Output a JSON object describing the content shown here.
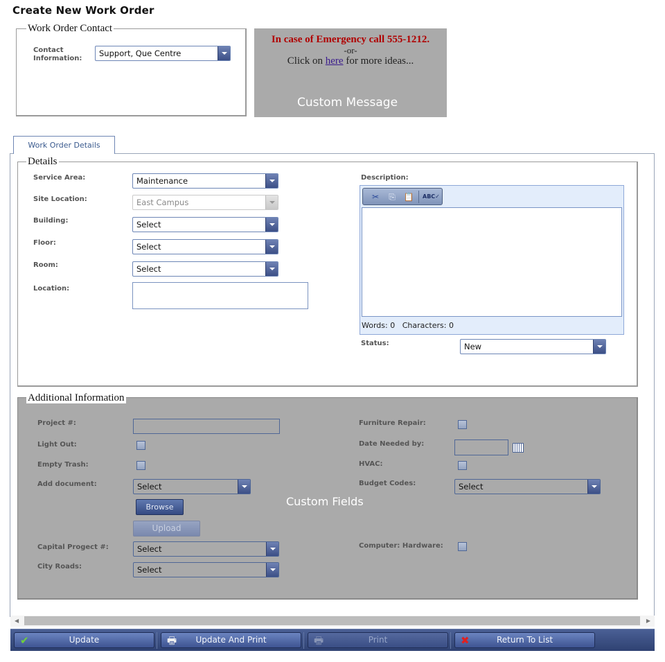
{
  "page": {
    "title": "Create New Work Order"
  },
  "contact": {
    "legend": "Work Order Contact",
    "label_line1": "Contact",
    "label_line2": "Information:",
    "value": "Support, Que Centre"
  },
  "custom_message": {
    "emergency": "In case of Emergency call 555-1212.",
    "or": "-or-",
    "click_prefix": "Click on ",
    "link_text": "here",
    "click_suffix": " for more ideas...",
    "overlay_label": "Custom Message"
  },
  "tabs": [
    {
      "label": "Work Order Details",
      "active": true
    }
  ],
  "details": {
    "legend": "Details",
    "fields": {
      "service_area": {
        "label": "Service Area:",
        "value": "Maintenance"
      },
      "site_location": {
        "label": "Site Location:",
        "value": "East Campus",
        "disabled": true
      },
      "building": {
        "label": "Building:",
        "value": "Select"
      },
      "floor": {
        "label": "Floor:",
        "value": "Select"
      },
      "room": {
        "label": "Room:",
        "value": "Select"
      },
      "location": {
        "label": "Location:",
        "value": ""
      }
    },
    "description": {
      "label": "Description:",
      "toolbar": [
        "cut-icon",
        "copy-icon",
        "paste-icon",
        "spellcheck-icon"
      ],
      "words_label": "Words: 0",
      "characters_label": "Characters: 0",
      "value": ""
    },
    "status": {
      "label": "Status:",
      "value": "New"
    }
  },
  "additional": {
    "legend": "Additional Information",
    "overlay_label": "Custom Fields",
    "left": {
      "project": {
        "label": "Project #:",
        "value": ""
      },
      "light_out": {
        "label": "Light Out:",
        "checked": false
      },
      "empty_trash": {
        "label": "Empty Trash:",
        "checked": false
      },
      "add_document": {
        "label": "Add document:",
        "value": "Select"
      },
      "browse_label": "Browse",
      "upload_label": "Upload",
      "capital_project": {
        "label": "Capital Progect #:",
        "value": "Select"
      },
      "city_roads": {
        "label": "City Roads:",
        "value": "Select"
      }
    },
    "right": {
      "furniture_repair": {
        "label": "Furniture Repair:",
        "checked": false
      },
      "date_needed": {
        "label": "Date Needed by:",
        "value": ""
      },
      "hvac": {
        "label": "HVAC:",
        "checked": false
      },
      "budget_codes": {
        "label": "Budget Codes:",
        "value": "Select"
      },
      "computer_hardware": {
        "label": "Computer: Hardware:",
        "checked": false
      }
    }
  },
  "footer": {
    "buttons": [
      {
        "label": "Update",
        "icon": "checkmark-icon",
        "enabled": true
      },
      {
        "label": "Update And Print",
        "icon": "printer-icon",
        "enabled": true
      },
      {
        "label": "Print",
        "icon": "printer-icon",
        "enabled": false
      },
      {
        "label": "Return To List",
        "icon": "close-icon",
        "enabled": true
      }
    ]
  },
  "colors": {
    "emergency_text": "#b00000",
    "footer_bar": "#2f4272",
    "custom_panel": "#aaaaaa"
  }
}
